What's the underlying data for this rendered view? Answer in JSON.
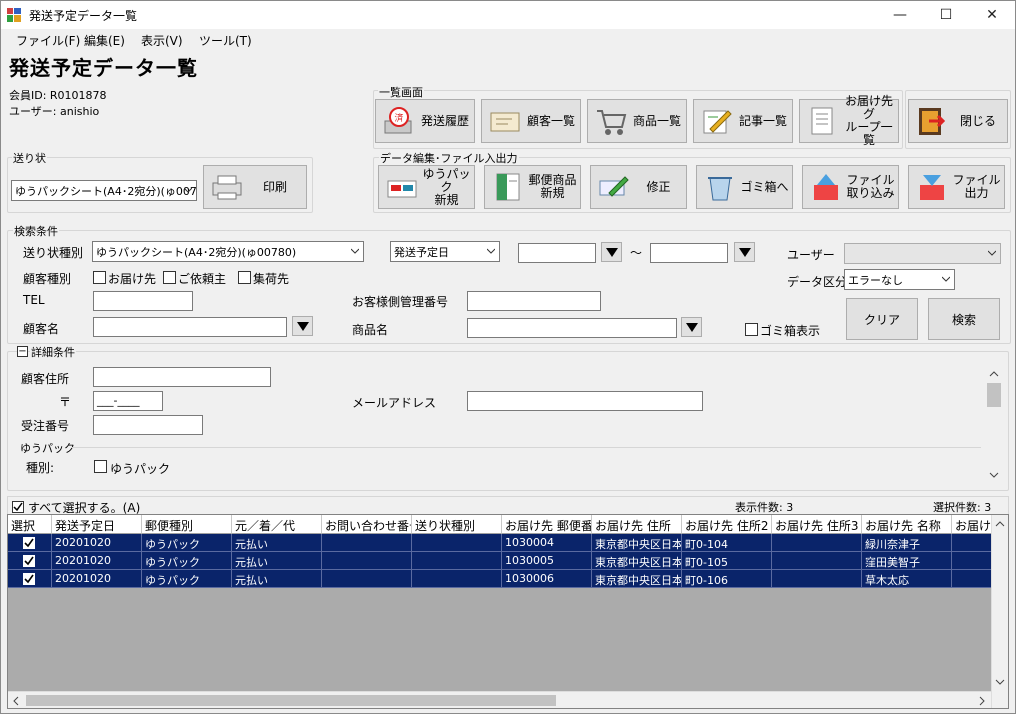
{
  "window": {
    "title": "発送予定データ一覧",
    "minimize": "—",
    "maximize": "☐",
    "close": "✕"
  },
  "menu": [
    "ファイル(F)",
    "編集(E)",
    "表示(V)",
    "ツール(T)"
  ],
  "page_title": "発送予定データ一覧",
  "member": {
    "id_label": "会員ID: R0101878",
    "user_label": "ユーザー: anishio"
  },
  "list_screen": {
    "label": "一覧画面",
    "buttons": [
      "発送履歴",
      "顧客一覧",
      "商品一覧",
      "記事一覧",
      "お届け先グ\nループ一覧",
      "閉じる"
    ]
  },
  "invoice": {
    "label": "送り状",
    "selected": "ゆうパックシート(A4･2宛分)(ゅ007",
    "print": "印刷"
  },
  "data_edit": {
    "label": "データ編集･ファイル入出力",
    "buttons": [
      "ゆうパック\n新規",
      "郵便商品\n新規",
      "修正",
      "ゴミ箱へ",
      "ファイル\n取り込み",
      "ファイル\n出力"
    ]
  },
  "search": {
    "label": "検索条件",
    "invoice_type_label": "送り状種別",
    "invoice_type_value": "ゆうパックシート(A4･2宛分)(ゅ00780)",
    "date_type_value": "発送予定日",
    "date_from": "",
    "tilde": "～",
    "date_to": "",
    "user_label": "ユーザー",
    "user_value": "",
    "customer_type_label": "顧客種別",
    "customer_types": [
      "お届け先",
      "ご依頼主",
      "集荷先"
    ],
    "data_class_label": "データ区分",
    "data_class_value": "エラーなし",
    "tel_label": "TEL",
    "tel_value": "",
    "customer_mgmt_label": "お客様側管理番号",
    "customer_mgmt_value": "",
    "customer_name_label": "顧客名",
    "customer_name_value": "",
    "product_name_label": "商品名",
    "product_name_value": "",
    "trash_label": "ゴミ箱表示",
    "clear": "クリア",
    "search": "検索"
  },
  "detail": {
    "label": "詳細条件",
    "toggle": "−",
    "address_label": "顧客住所",
    "address_value": "",
    "postal_label": "〒",
    "postal_value": "___-____",
    "mail_label": "メールアドレス",
    "mail_value": "",
    "order_label": "受注番号",
    "order_value": "",
    "yupack_section": "ゆうパック",
    "kind_label": "種別:",
    "kind_option": "ゆうパック"
  },
  "list": {
    "select_all": "すべて選択する。(A)",
    "display_count": "表示件数: 3",
    "selected_count": "選択件数: 3",
    "columns": [
      "選択",
      "発送予定日",
      "郵便種別",
      "元／着／代",
      "お問い合わせ番号",
      "送り状種別",
      "お届け先 郵便番号",
      "お届け先 住所",
      "お届け先 住所2",
      "お届け先 住所3",
      "お届け先 名称",
      "お届け先"
    ],
    "rows": [
      [
        "",
        "20201020",
        "ゆうパック",
        "元払い",
        "",
        "",
        "1030004",
        "東京都中央区日本橋",
        "町0-104",
        "",
        "緑川奈津子",
        ""
      ],
      [
        "",
        "20201020",
        "ゆうパック",
        "元払い",
        "",
        "",
        "1030005",
        "東京都中央区日本橋",
        "町0-105",
        "",
        "窪田美智子",
        ""
      ],
      [
        "",
        "20201020",
        "ゆうパック",
        "元払い",
        "",
        "",
        "1030006",
        "東京都中央区日本橋",
        "町0-106",
        "",
        "草木太応",
        ""
      ]
    ]
  }
}
